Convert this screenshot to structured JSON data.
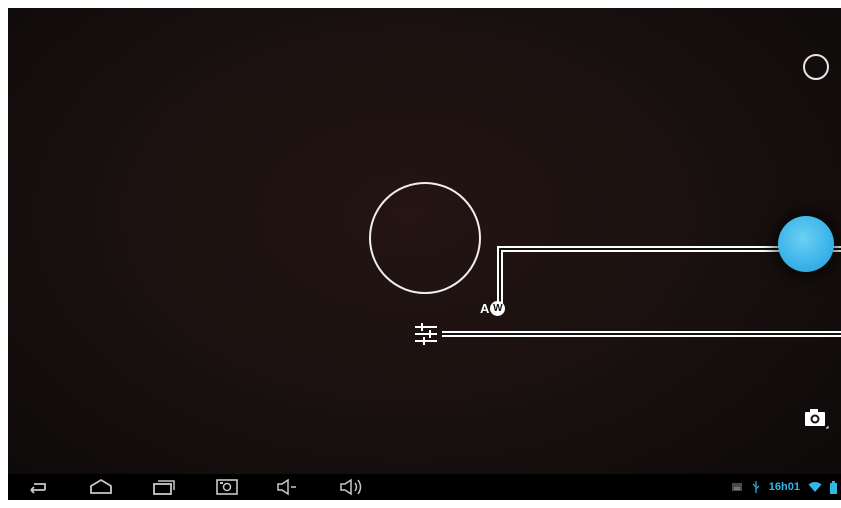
{
  "camera": {
    "white_balance_badge": {
      "letter_a": "A",
      "letter_w": "W"
    },
    "icons": {
      "focus": "focus-ring",
      "white_balance": "white-balance-auto-icon",
      "settings": "settings-sliders-icon",
      "mode": "mode-circle-icon",
      "shutter": "shutter-button",
      "switch_camera": "camera-switch-icon"
    },
    "colors": {
      "shutter": "#33b5e5",
      "background": "#1a1110"
    }
  },
  "navbar": {
    "buttons": [
      "back-icon",
      "home-icon",
      "recent-apps-icon",
      "screenshot-icon",
      "volume-down-icon",
      "volume-up-icon"
    ]
  },
  "status_bar": {
    "time": "16h01",
    "icons": [
      "gallery-icon",
      "usb-icon",
      "wifi-icon",
      "battery-icon"
    ],
    "accent_color": "#33b5e5"
  }
}
